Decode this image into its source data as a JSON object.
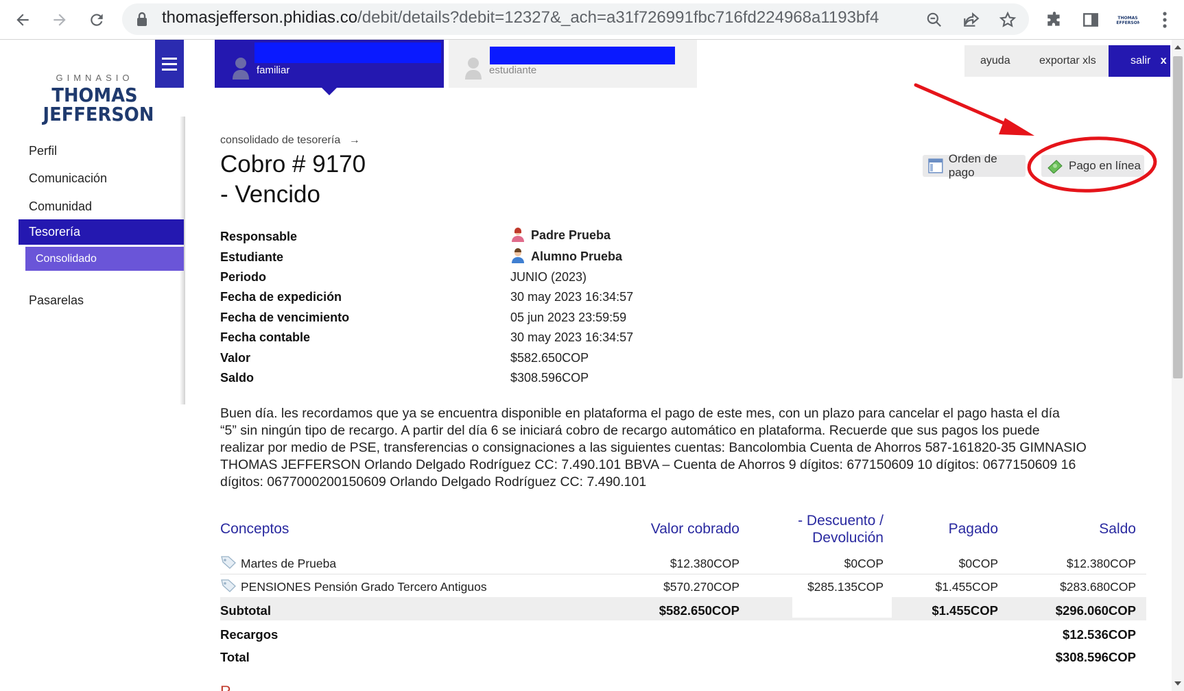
{
  "browser": {
    "url_host": "thomasjefferson.phidias.co",
    "url_path": "/debit/details?debit=12327&_ach=a31f726991fbc716fd224968a1193bf4"
  },
  "sidebar": {
    "logo_top": "GIMNASIO",
    "logo_line1": "THOMAS",
    "logo_line2": "JEFFERSON",
    "items": [
      {
        "label": "Perfil"
      },
      {
        "label": "Comunicación"
      },
      {
        "label": "Comunidad"
      },
      {
        "label": "Tesorería"
      },
      {
        "label": "Consolidado"
      },
      {
        "label": "Pasarelas"
      }
    ]
  },
  "topbar": {
    "tab_familiar": "familiar",
    "tab_estudiante": "estudiante",
    "ayuda": "ayuda",
    "exportar": "exportar xls",
    "salir": "salir",
    "salir_x": "x"
  },
  "main": {
    "breadcrumb": "consolidado de tesorería",
    "breadcrumb_arrow": "→",
    "title_line1": "Cobro # 9170",
    "title_line2": "- Vencido",
    "btn_orden": "Orden de pago",
    "btn_pago": "Pago en línea",
    "details": [
      {
        "label": "Responsable",
        "value": "Padre Prueba"
      },
      {
        "label": "Estudiante",
        "value": "Alumno Prueba"
      },
      {
        "label": "Periodo",
        "value": "JUNIO (2023)"
      },
      {
        "label": "Fecha de expedición",
        "value": "30 may 2023 16:34:57"
      },
      {
        "label": "Fecha de vencimiento",
        "value": "05 jun 2023 23:59:59"
      },
      {
        "label": "Fecha contable",
        "value": "30 may 2023 16:34:57"
      },
      {
        "label": "Valor",
        "value": "$582.650COP"
      },
      {
        "label": "Saldo",
        "value": "$308.596COP"
      }
    ],
    "message_lines": [
      "Buen día. les recordamos que ya se encuentra disponible en plataforma el pago de este mes, con un plazo para cancelar el pago hasta el día",
      "“5” sin ningún tipo de recargo. A partir del día 6 se iniciará cobro de recargo automático en plataforma. Recuerde que sus pagos los puede",
      "realizar por medio de PSE, transferencias o consignaciones a las siguientes cuentas: Bancolombia Cuenta de Ahorros 587-161820-35 GIMNASIO",
      "THOMAS JEFFERSON Orlando Delgado Rodríguez CC: 7.490.101 BBVA – Cuenta de Ahorros 9 dígitos: 677150609 10 dígitos: 0677150609 16",
      "dígitos: 0677000200150609 Orlando Delgado Rodríguez CC: 7.490.101"
    ],
    "table": {
      "headers": {
        "conceptos": "Conceptos",
        "valor": "Valor cobrado",
        "descuento_1": "- Descuento /",
        "descuento_2": "Devolución",
        "pagado": "Pagado",
        "saldo": "Saldo"
      },
      "rows": [
        {
          "concepto": "Martes de Prueba",
          "valor": "$12.380COP",
          "descuento": "$0COP",
          "pagado": "$0COP",
          "saldo": "$12.380COP"
        },
        {
          "concepto": "PENSIONES Pensión Grado Tercero Antiguos",
          "valor": "$570.270COP",
          "descuento": "$285.135COP",
          "pagado": "$1.455COP",
          "saldo": "$283.680COP"
        }
      ],
      "subtotal": {
        "label": "Subtotal",
        "valor": "$582.650COP",
        "pagado": "$1.455COP",
        "saldo": "$296.060COP"
      },
      "recargos": {
        "label": "Recargos",
        "saldo": "$12.536COP"
      },
      "total": {
        "label": "Total",
        "saldo": "$308.596COP"
      }
    },
    "partial_next_heading": "R"
  },
  "colors": {
    "brand": "#2418b0",
    "brand_light": "#6a55d8",
    "annotation": "#e5141a",
    "redaction": "#0a1aff"
  }
}
